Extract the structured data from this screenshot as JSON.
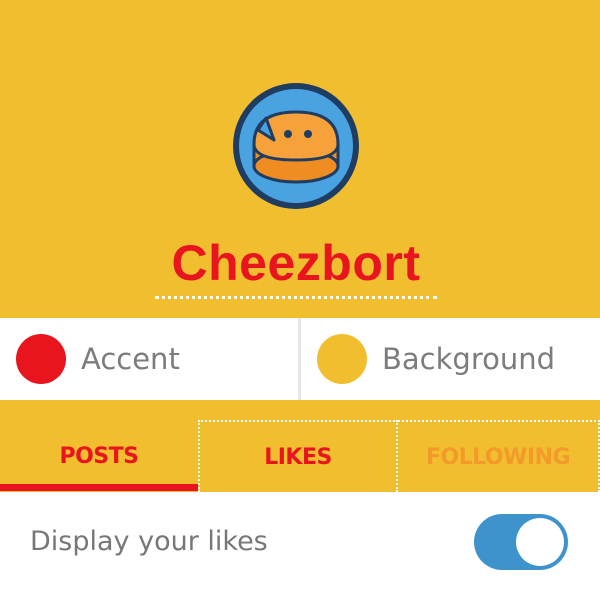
{
  "profile": {
    "username": "Cheezbort",
    "avatar_icon": "cheese-wheel-face-icon"
  },
  "colors": {
    "accent_label": "Accent",
    "accent_value": "#e8151f",
    "background_label": "Background",
    "background_value": "#f1be2f"
  },
  "tabs": [
    {
      "label": "POSTS",
      "active": true
    },
    {
      "label": "LIKES",
      "active": false
    },
    {
      "label": "FOLLOWING",
      "active": false
    }
  ],
  "settings": {
    "display_likes_label": "Display your likes",
    "display_likes_enabled": true,
    "toggle_color": "#3f93cd"
  }
}
